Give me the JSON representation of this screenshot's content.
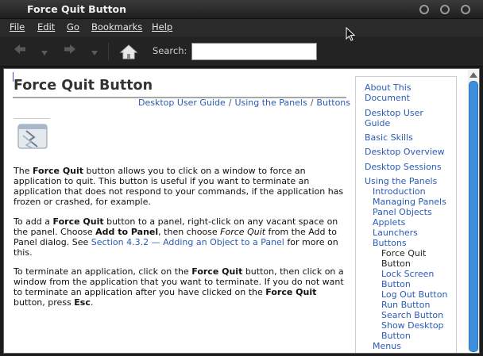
{
  "window": {
    "title": "Force Quit Button"
  },
  "menubar": {
    "items": [
      "File",
      "Edit",
      "Go",
      "Bookmarks",
      "Help"
    ]
  },
  "toolbar": {
    "back_icon": "left-arrow-icon",
    "forward_icon": "right-arrow-icon",
    "home_icon": "home-icon",
    "search_label": "Search:",
    "search_value": ""
  },
  "page": {
    "title": "Force Quit Button",
    "breadcrumb": [
      "Desktop User Guide",
      "Using the Panels",
      "Buttons"
    ],
    "p1": {
      "a": "The ",
      "b": "Force Quit",
      "c": " button allows you to click on a window to force an application to quit. This button is useful if you want to terminate an application that does not respond to your commands, if the application has frozen or crashed, for example."
    },
    "p2": {
      "a": "To add a ",
      "b": "Force Quit",
      "c": " button to a panel, right-click on any vacant space on the panel. Choose ",
      "d": "Add to Panel",
      "e": ", then choose ",
      "f": "Force Quit",
      "g": " from the Add to Panel dialog. See ",
      "link": "Section 4.3.2 — Adding an Object to a Panel",
      "h": " for more on this."
    },
    "p3": {
      "a": "To terminate an application, click on the ",
      "b": "Force Quit",
      "c": " button, then click on a window from the application that you want to terminate. If you do not want to terminate an application after you have clicked on the ",
      "d": "Force Quit",
      "e": " button, press ",
      "f": "Esc",
      "g": "."
    }
  },
  "sidebar": {
    "about_1": "About This",
    "about_2": "Document",
    "dug_1": "Desktop User",
    "dug_2": "Guide",
    "basic": "Basic Skills",
    "overview": "Desktop Overview",
    "sessions": "Desktop Sessions",
    "using_panels": "Using the Panels",
    "introduction": "Introduction",
    "managing": "Managing Panels",
    "objects": "Panel Objects",
    "applets": "Applets",
    "launchers": "Launchers",
    "buttons": "Buttons",
    "fq_1": "Force Quit",
    "fq_2": "Button",
    "ls_1": "Lock Screen",
    "ls_2": "Button",
    "lo": "Log Out Button",
    "run": "Run Button",
    "search": "Search Button",
    "sd_1": "Show Desktop",
    "sd_2": "Button",
    "menus": "Menus"
  },
  "colors": {
    "link": "#2a5bb8",
    "scroll_thumb": "#3e8fdb",
    "chrome": "#232323"
  }
}
